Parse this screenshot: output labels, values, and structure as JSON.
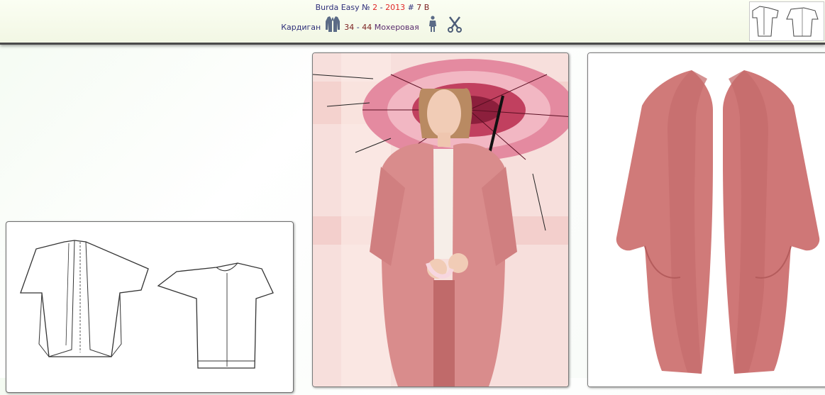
{
  "header": {
    "magazine": "Burda Easy",
    "number_sign": "№",
    "issue": "2",
    "dash": "-",
    "year": "2013",
    "hash": "#",
    "model": "7 B",
    "garment": "Кардиган",
    "size_from": "34",
    "size_dash": "-",
    "size_to": "44",
    "fabric": "Мохеровая"
  },
  "icons": {
    "garment": "cardigan-icon",
    "figure": "woman-figure-icon",
    "cutting": "scissors-icon"
  },
  "images": {
    "thumbnail": "technical-drawing-thumbnail",
    "sketch": "technical-drawing-front-back",
    "photo": "model-photo-with-umbrella",
    "product": "pink-mohair-cardigan"
  },
  "colors": {
    "accent_red": "#e02727",
    "navy_text": "#2f2f7a",
    "maroon_text": "#7a1f1f",
    "cardigan_pink": "#cf7b7b"
  }
}
